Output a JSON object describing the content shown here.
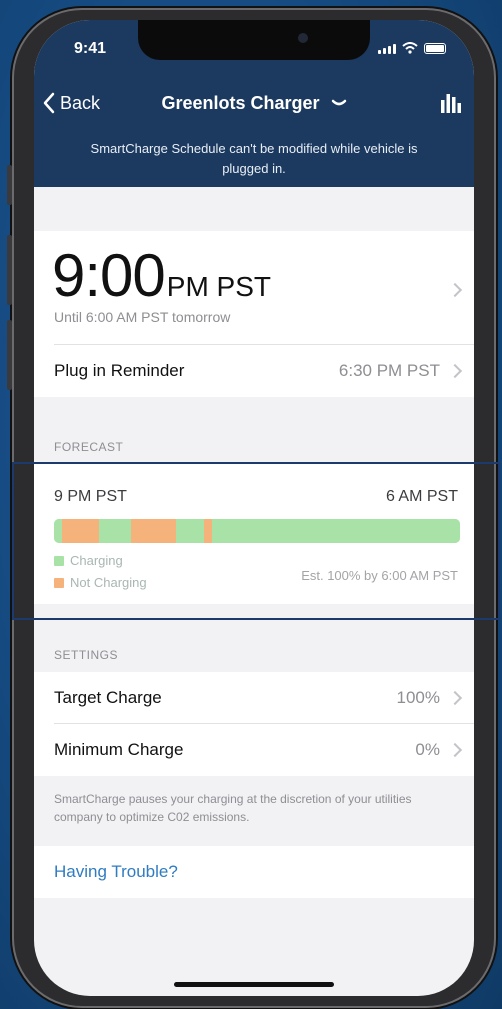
{
  "status_bar": {
    "time": "9:41"
  },
  "nav": {
    "back_label": "Back",
    "title": "Greenlots Charger"
  },
  "notice": "SmartCharge Schedule can't be modified while vehicle is plugged in.",
  "schedule": {
    "time": "9:00",
    "ampm": "PM PST",
    "until": "Until 6:00 AM PST tomorrow"
  },
  "reminder": {
    "label": "Plug in Reminder",
    "value": "6:30 PM PST"
  },
  "forecast": {
    "header": "FORECAST",
    "start": "9 PM PST",
    "end": "6 AM PST",
    "legend_charging": "Charging",
    "legend_not_charging": "Not Charging",
    "estimate": "Est. 100% by 6:00 AM PST",
    "segments": [
      {
        "state": "charging",
        "start": 0.0,
        "end": 0.02
      },
      {
        "state": "not_charging",
        "start": 0.02,
        "end": 0.11
      },
      {
        "state": "charging",
        "start": 0.11,
        "end": 0.19
      },
      {
        "state": "not_charging",
        "start": 0.19,
        "end": 0.3
      },
      {
        "state": "charging",
        "start": 0.3,
        "end": 0.37
      },
      {
        "state": "not_charging",
        "start": 0.37,
        "end": 0.39
      },
      {
        "state": "charging",
        "start": 0.39,
        "end": 1.0
      }
    ],
    "colors": {
      "charging": "#a8e2a7",
      "not_charging": "#f5b27a"
    }
  },
  "settings": {
    "header": "SETTINGS",
    "target_label": "Target Charge",
    "target_value": "100%",
    "minimum_label": "Minimum Charge",
    "minimum_value": "0%",
    "note": "SmartCharge pauses your charging at the discretion of your utilities company to optimize C02 emissions."
  },
  "help": {
    "trouble_label": "Having Trouble?"
  },
  "colors": {
    "header_bg": "#1c3a5f",
    "link": "#2f7cc1"
  },
  "icons": [
    "back-chevron-icon",
    "chevron-down-icon",
    "bar-chart-icon",
    "signal-icon",
    "wifi-icon",
    "battery-icon",
    "chevron-right-icon"
  ]
}
